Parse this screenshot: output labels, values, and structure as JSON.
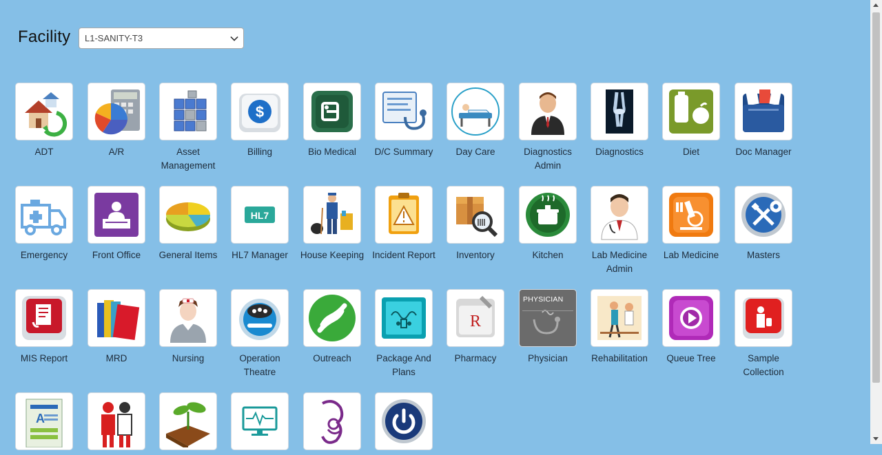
{
  "facility": {
    "label": "Facility",
    "selected": "L1-SANITY-T3"
  },
  "physician_icon_text": "PHYSICIAN",
  "hl7_icon_text": "HL7",
  "tiles": [
    {
      "label": "ADT",
      "icon": "house-cycle-icon"
    },
    {
      "label": "A/R",
      "icon": "calculator-chart-icon"
    },
    {
      "label": "Asset Management",
      "icon": "cubes-icon"
    },
    {
      "label": "Billing",
      "icon": "dollar-icon"
    },
    {
      "label": "Bio Medical",
      "icon": "bed-device-icon"
    },
    {
      "label": "D/C Summary",
      "icon": "stethoscope-report-icon"
    },
    {
      "label": "Day Care",
      "icon": "patient-bed-icon"
    },
    {
      "label": "Diagnostics Admin",
      "icon": "doctor-admin-icon"
    },
    {
      "label": "Diagnostics",
      "icon": "xray-icon"
    },
    {
      "label": "Diet",
      "icon": "diet-icon"
    },
    {
      "label": "Doc Manager",
      "icon": "folder-docs-icon"
    },
    {
      "label": "Emergency",
      "icon": "ambulance-icon"
    },
    {
      "label": "Front Office",
      "icon": "reception-desk-icon"
    },
    {
      "label": "General Items",
      "icon": "pie-chart-icon"
    },
    {
      "label": "HL7 Manager",
      "icon": "hl7-icon"
    },
    {
      "label": "House Keeping",
      "icon": "housekeeper-icon"
    },
    {
      "label": "Incident Report",
      "icon": "warning-clipboard-icon"
    },
    {
      "label": "Inventory",
      "icon": "box-magnifier-icon"
    },
    {
      "label": "Kitchen",
      "icon": "cooking-pot-icon"
    },
    {
      "label": "Lab Medicine Admin",
      "icon": "lab-doctor-icon"
    },
    {
      "label": "Lab Medicine",
      "icon": "microscope-icon"
    },
    {
      "label": "Masters",
      "icon": "tools-icon"
    },
    {
      "label": "MIS Report",
      "icon": "report-icon"
    },
    {
      "label": "MRD",
      "icon": "records-books-icon"
    },
    {
      "label": "Nursing",
      "icon": "nurse-icon"
    },
    {
      "label": "Operation Theatre",
      "icon": "surgery-light-icon"
    },
    {
      "label": "Outreach",
      "icon": "helping-hands-icon"
    },
    {
      "label": "Package And Plans",
      "icon": "package-plans-icon"
    },
    {
      "label": "Pharmacy",
      "icon": "pharmacy-mortar-icon"
    },
    {
      "label": "Physician",
      "icon": "physician-icon"
    },
    {
      "label": "Rehabilitation",
      "icon": "rehab-icon"
    },
    {
      "label": "Queue Tree",
      "icon": "queue-play-icon"
    },
    {
      "label": "Sample Collection",
      "icon": "sample-collection-icon"
    },
    {
      "label": "",
      "icon": "form-document-icon"
    },
    {
      "label": "",
      "icon": "people-icon"
    },
    {
      "label": "",
      "icon": "sprout-icon"
    },
    {
      "label": "",
      "icon": "monitor-pulse-icon"
    },
    {
      "label": "",
      "icon": "mother-child-icon"
    },
    {
      "label": "",
      "icon": "power-icon"
    }
  ]
}
